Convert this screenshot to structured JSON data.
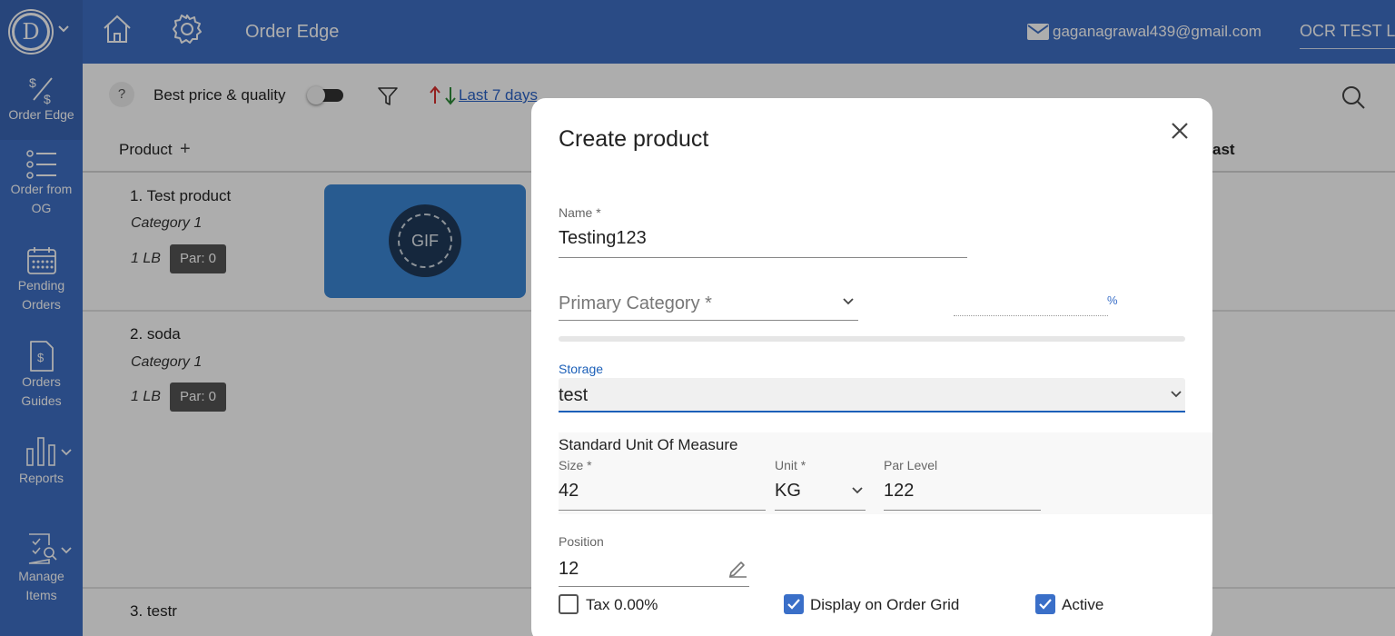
{
  "header": {
    "logo_letter": "D",
    "app_title": "Order Edge",
    "email": "gaganagrawal439@gmail.com",
    "company": "OCR TEST L"
  },
  "sidebar": {
    "items": [
      {
        "label": "Order Edge",
        "icon": "dollar-split-icon",
        "active": true
      },
      {
        "label": "Order from OG",
        "icon": "list-icon"
      },
      {
        "label": "Pending Orders",
        "icon": "calendar-icon"
      },
      {
        "label": "Orders Guides",
        "icon": "dollar-document-icon"
      },
      {
        "label": "Reports",
        "icon": "bar-chart-icon"
      },
      {
        "label": "Manage Items",
        "icon": "checklist-search-icon"
      }
    ]
  },
  "toolbar": {
    "help": "?",
    "best_price_label": "Best price & quality",
    "date_filter": "Last 7 days"
  },
  "table": {
    "columns": {
      "product": "Product",
      "last": "ast"
    },
    "rows": [
      {
        "name": "1. Test product",
        "category": "Category 1",
        "uom": "1 LB",
        "par": "Par: 0",
        "image_label": "GIF"
      },
      {
        "name": "2. soda",
        "category": "Category 1",
        "uom": "1 LB",
        "par": "Par: 0"
      },
      {
        "name": "3. testr",
        "category": "",
        "uom": "",
        "par": ""
      }
    ]
  },
  "dialog": {
    "title": "Create product",
    "name": {
      "label": "Name *",
      "value": "Testing123"
    },
    "primary_category": {
      "placeholder": "Primary Category *"
    },
    "percent_suffix": "%",
    "storage": {
      "label": "Storage",
      "value": "test"
    },
    "uom": {
      "title": "Standard Unit Of Measure",
      "size": {
        "label": "Size *",
        "value": "42"
      },
      "unit": {
        "label": "Unit *",
        "value": "KG"
      },
      "par_level": {
        "label": "Par Level",
        "value": "122"
      }
    },
    "position": {
      "label": "Position",
      "value": "12"
    },
    "checkboxes": {
      "tax": {
        "label": "Tax 0.00%",
        "checked": false
      },
      "display_on_grid": {
        "label": "Display on Order Grid",
        "checked": true
      },
      "active": {
        "label": "Active",
        "checked": true
      }
    }
  },
  "colors": {
    "primary": "#3f6fc4",
    "link": "#2b63c8",
    "focus": "#1b5fb8",
    "checkbox": "#3a6fc8"
  }
}
